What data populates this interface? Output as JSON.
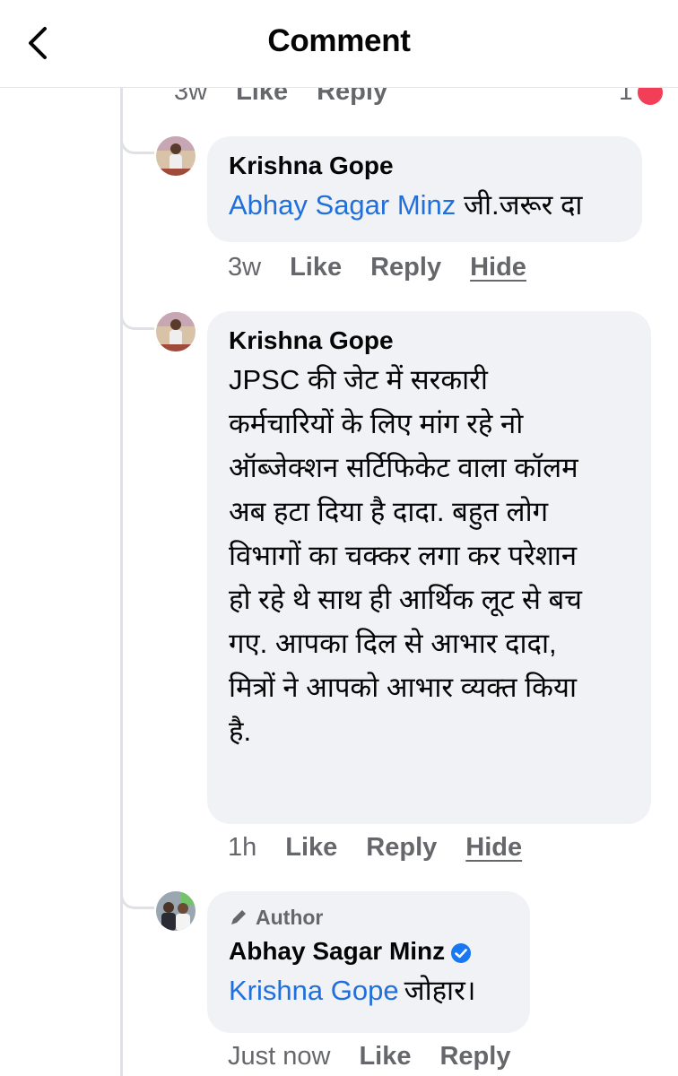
{
  "header": {
    "title": "Comment"
  },
  "top_row": {
    "time": "3w",
    "like": "Like",
    "reply": "Reply",
    "reaction_count": "1"
  },
  "comments": [
    {
      "author": "Krishna Gope",
      "mention": "Abhay Sagar Minz",
      "text": "जी.जरूर दा",
      "time": "3w",
      "like": "Like",
      "reply": "Reply",
      "hide": "Hide"
    },
    {
      "author": "Krishna Gope",
      "lines": [
        "JPSC की जेट में सरकारी",
        "कर्मचारियों के लिए मांग रहे नो",
        "ऑब्जेक्शन सर्टिफिकेट वाला कॉलम",
        "अब हटा दिया है दादा. बहुत लोग",
        "विभागों का चक्कर लगा कर परेशान",
        "हो रहे थे साथ ही आर्थिक लूट से बच",
        "गए. आपका दिल से आभार दादा,",
        "मित्रों ने आपको आभार व्यक्त किया",
        "है."
      ],
      "time": "1h",
      "like": "Like",
      "reply": "Reply",
      "hide": "Hide"
    },
    {
      "badge": "Author",
      "author": "Abhay Sagar Minz",
      "mention": "Krishna Gope",
      "text": "जोहार।",
      "time": "Just now",
      "like": "Like",
      "reply": "Reply"
    }
  ],
  "colors": {
    "mention": "#216fdb",
    "bubble": "#f0f2f5",
    "meta": "#65676b",
    "verified": "#1877f2",
    "reaction": "#f33e58"
  },
  "icons": [
    "back-arrow-icon",
    "heart-reaction-icon",
    "pencil-icon",
    "verified-badge-icon"
  ]
}
